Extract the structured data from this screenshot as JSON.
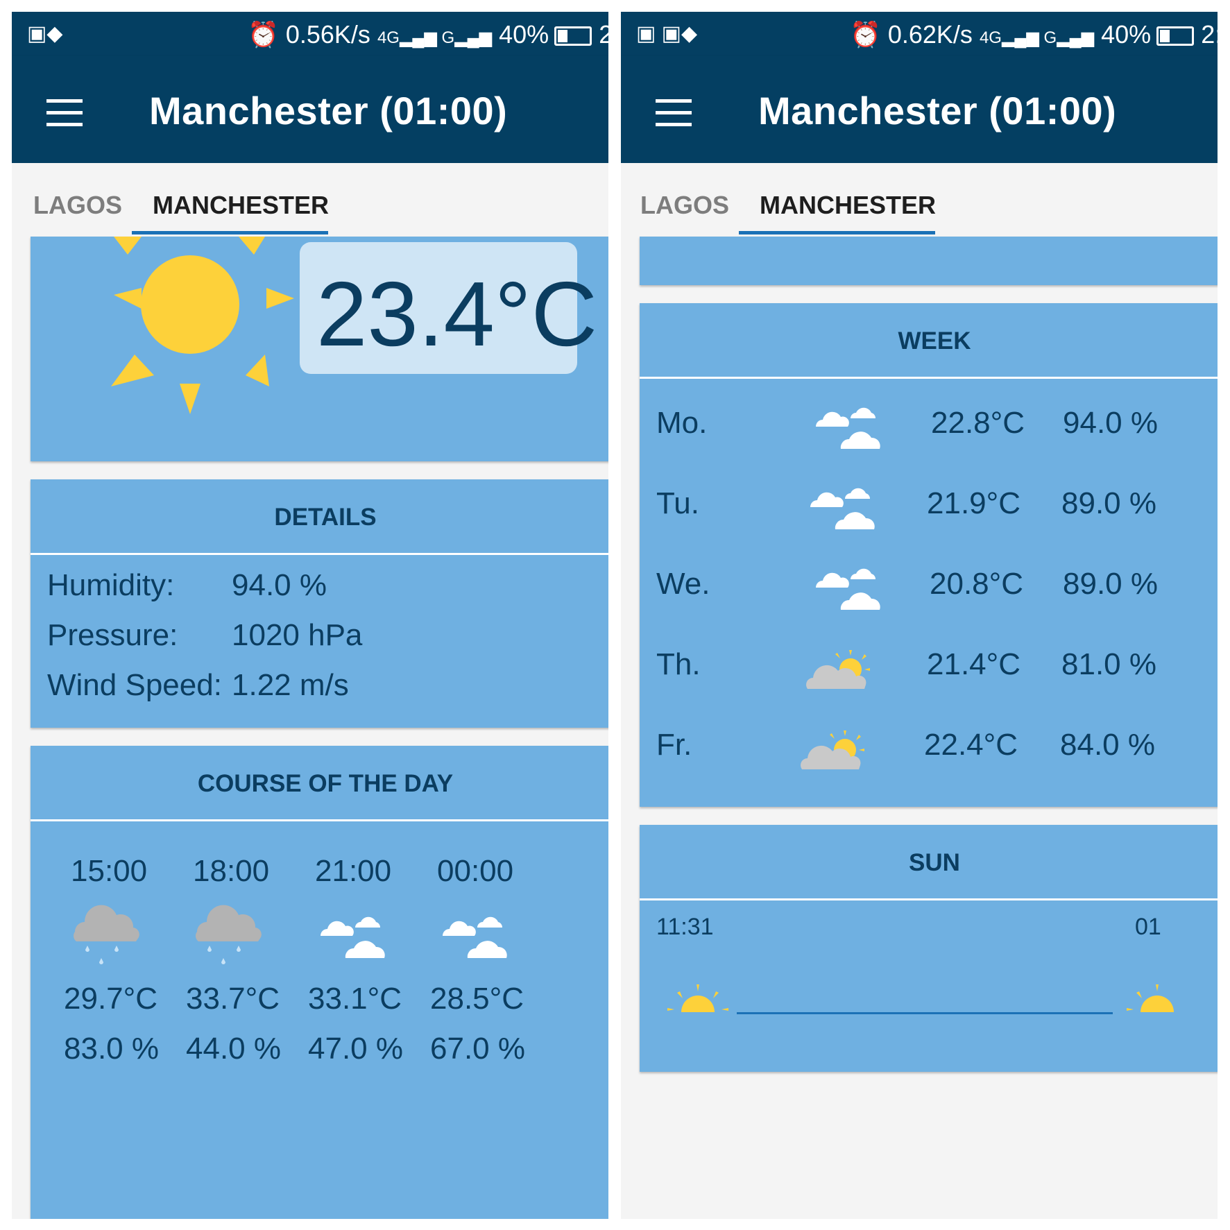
{
  "left": {
    "status": {
      "speed": "0.56K/s",
      "battery": "40%",
      "time": "2:"
    },
    "app_title": "Manchester (01:00)",
    "tabs": [
      "LAGOS",
      "MANCHESTER"
    ],
    "current": {
      "temperature": "23.4°C",
      "icon": "sun-icon"
    },
    "details": {
      "header": "DETAILS",
      "rows": [
        {
          "label": "Humidity:",
          "value": "94.0 %"
        },
        {
          "label": "Pressure:",
          "value": "1020 hPa"
        },
        {
          "label": "Wind Speed:",
          "value": "1.22 m/s"
        }
      ]
    },
    "course": {
      "header": "COURSE OF THE DAY",
      "hours": [
        {
          "time": "15:00",
          "icon": "rain-cloud-icon",
          "temp": "29.7°C",
          "humidity": "83.0 %"
        },
        {
          "time": "18:00",
          "icon": "rain-cloud-icon",
          "temp": "33.7°C",
          "humidity": "44.0 %"
        },
        {
          "time": "21:00",
          "icon": "clouds-icon",
          "temp": "33.1°C",
          "humidity": "47.0 %"
        },
        {
          "time": "00:00",
          "icon": "clouds-icon",
          "temp": "28.5°C",
          "humidity": "67.0 %"
        }
      ]
    }
  },
  "right": {
    "status": {
      "speed": "0.62K/s",
      "battery": "40%",
      "time": "2:"
    },
    "app_title": "Manchester (01:00)",
    "tabs": [
      "LAGOS",
      "MANCHESTER"
    ],
    "week": {
      "header": "WEEK",
      "days": [
        {
          "day": "Mo.",
          "icon": "clouds-icon",
          "temp": "22.8°C",
          "humidity": "94.0 %"
        },
        {
          "day": "Tu.",
          "icon": "clouds-icon",
          "temp": "21.9°C",
          "humidity": "89.0 %"
        },
        {
          "day": "We.",
          "icon": "clouds-icon",
          "temp": "20.8°C",
          "humidity": "89.0 %"
        },
        {
          "day": "Th.",
          "icon": "partly-cloudy-icon",
          "temp": "21.4°C",
          "humidity": "81.0 %"
        },
        {
          "day": "Fr.",
          "icon": "partly-cloudy-icon",
          "temp": "22.4°C",
          "humidity": "84.0 %"
        }
      ]
    },
    "sun": {
      "header": "SUN",
      "sunrise": "11:31",
      "sunset": "01"
    }
  },
  "colors": {
    "appbar": "#043f62",
    "card": "#6fb0e1",
    "text": "#0b3d60",
    "accent": "#1b71b6",
    "sun": "#fdd13a"
  }
}
